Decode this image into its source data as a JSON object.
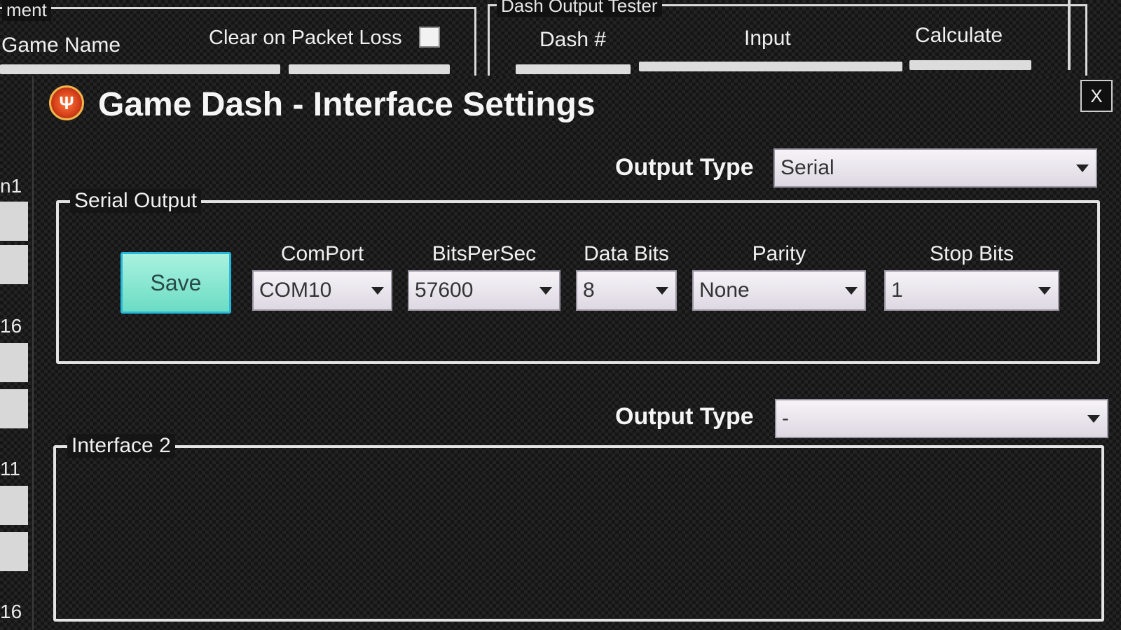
{
  "background_window": {
    "left_group_legend": "ment",
    "right_group_legend": "Dash Output Tester",
    "game_name_label": "Game Name",
    "clear_on_packet_loss_label": "Clear on Packet Loss",
    "dash_number_label": "Dash #",
    "input_label": "Input",
    "calculate_label": "Calculate",
    "left_numbers": [
      "n1",
      "16",
      "11",
      "16"
    ]
  },
  "dialog": {
    "title": "Game Dash - Interface Settings",
    "close_label": "X",
    "interface1": {
      "output_type_label": "Output Type",
      "output_type_value": "Serial",
      "group_legend": "Serial Output",
      "save_label": "Save",
      "fields": {
        "comport": {
          "label": "ComPort",
          "value": "COM10"
        },
        "bits_per_sec": {
          "label": "BitsPerSec",
          "value": "57600"
        },
        "data_bits": {
          "label": "Data Bits",
          "value": "8"
        },
        "parity": {
          "label": "Parity",
          "value": "None"
        },
        "stop_bits": {
          "label": "Stop Bits",
          "value": "1"
        }
      }
    },
    "interface2": {
      "output_type_label": "Output Type",
      "output_type_value": "-",
      "group_legend": "Interface 2"
    }
  },
  "colors": {
    "save_button": "#8ae8d2",
    "save_border": "#26b8d9",
    "icon": "#d8421b"
  },
  "icons": {
    "app_icon": "joystick-icon",
    "dropdown": "chevron-down-icon"
  }
}
